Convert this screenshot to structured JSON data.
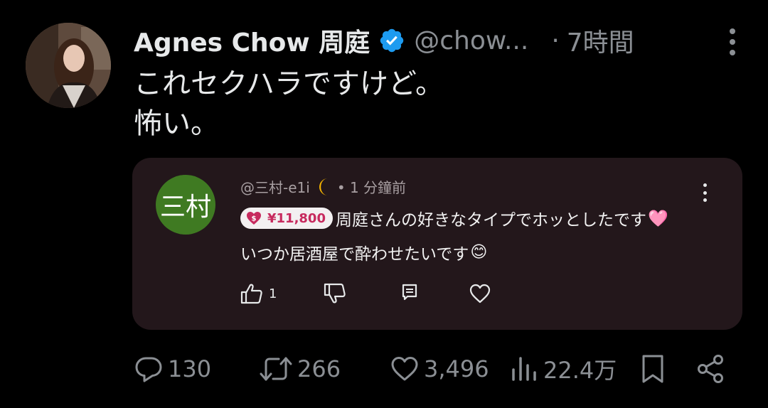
{
  "tweet": {
    "author_name": "Agnes Chow 周庭",
    "handle": "@chow...",
    "separator": "·",
    "time": "7時間",
    "text_lines": [
      "これセクハラですけど。",
      "怖い。"
    ]
  },
  "embedded": {
    "avatar_text": "三村",
    "avatar_color": "#3f7a22",
    "username": "@三村-e1i",
    "time_ago": "• 1 分鐘前",
    "superchat_amount": "¥11,800",
    "superchat_color": "#c72a5e",
    "line1": "周庭さんの好きなタイプでホッとしたです",
    "line1_emoji": "🩷",
    "line2": "いつか居酒屋で酔わせたいです",
    "line2_emoji": "😊",
    "like_count": "1"
  },
  "actions": {
    "replies": "130",
    "retweets": "266",
    "likes": "3,496",
    "views": "22.4万"
  },
  "colors": {
    "background": "#000000",
    "text": "#e7e9ea",
    "muted": "#8b8f94",
    "verified": "#1d9bf0",
    "card_bg": "#23171b"
  }
}
